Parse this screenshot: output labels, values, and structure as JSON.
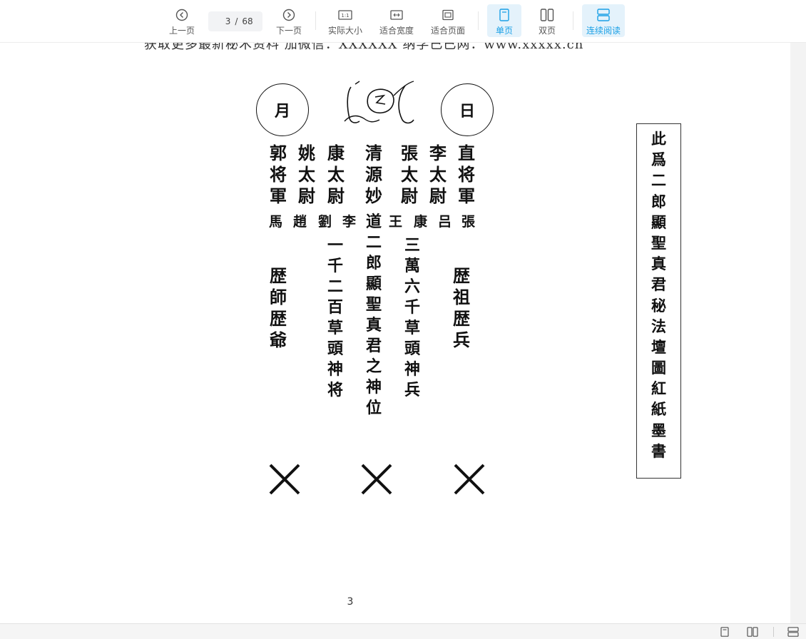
{
  "toolbar": {
    "prev": "上一页",
    "page_current": "3",
    "page_sep": "/",
    "page_total": "68",
    "next": "下一页",
    "actual_size": "实际大小",
    "fit_width": "适合宽度",
    "fit_page": "适合页面",
    "single_page": "单页",
    "double_page": "双页",
    "continuous": "连续阅读",
    "actual_size_icon_text": "1:1"
  },
  "document": {
    "cut_top_text": "获取更多最新秘术资料 加微信：XXXXXX 纳学已已网：www.xxxxx.cn",
    "circle_left": "月",
    "circle_right": "日",
    "columns": {
      "zhi_jiang_jun": [
        "直",
        "将",
        "軍"
      ],
      "li_tai_wei": [
        "李",
        "太",
        "尉"
      ],
      "zhang_tai_wei": [
        "張",
        "太",
        "尉"
      ],
      "qing_yuan": [
        "清",
        "源",
        "妙"
      ],
      "kang_tai_wei": [
        "康",
        "太",
        "尉"
      ],
      "yao_tai_wei": [
        "姚",
        "太",
        "尉"
      ],
      "guo_jiang_jun": [
        "郭",
        "将",
        "軍"
      ],
      "center_main": [
        "道",
        "二",
        "郎",
        "顯",
        "聖",
        "真",
        "君",
        "之",
        "神",
        "位"
      ],
      "san_wan": [
        "三",
        "萬",
        "六",
        "千",
        "草",
        "頭",
        "神",
        "兵"
      ],
      "yi_qian": [
        "一",
        "千",
        "二",
        "百",
        "草",
        "頭",
        "神",
        "将"
      ],
      "li_zu": [
        "歴",
        "祖",
        "歴",
        "兵"
      ],
      "li_shi": [
        "歴",
        "師",
        "歴",
        "爺"
      ]
    },
    "surname_row": {
      "zhang": "張",
      "lv": "吕",
      "kang": "康",
      "wang": "王",
      "li": "李",
      "liu": "劉",
      "zhao": "趙",
      "ma": "馬"
    },
    "side_note": [
      "此",
      "爲",
      "二",
      "郎",
      "顯",
      "聖",
      "真",
      "君",
      "秘",
      "法",
      "壇",
      "圖",
      "紅",
      "紙",
      "墨",
      "書"
    ],
    "page_number": "3"
  }
}
